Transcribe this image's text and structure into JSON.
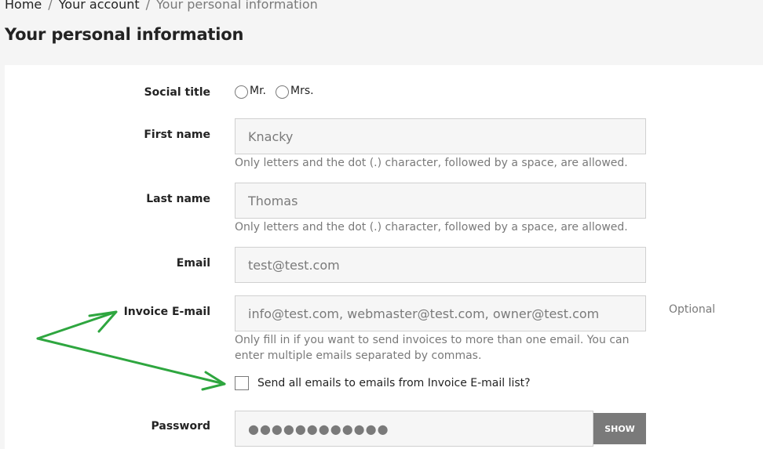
{
  "breadcrumb": {
    "items": [
      "Home",
      "Your account",
      "Your personal information"
    ],
    "separator": "/"
  },
  "page_title": "Your personal information",
  "form": {
    "social_title": {
      "label": "Social title",
      "options": [
        "Mr.",
        "Mrs."
      ]
    },
    "first_name": {
      "label": "First name",
      "value": "Knacky",
      "hint": "Only letters and the dot (.) character, followed by a space, are allowed."
    },
    "last_name": {
      "label": "Last name",
      "value": "Thomas",
      "hint": "Only letters and the dot (.) character, followed by a space, are allowed."
    },
    "email": {
      "label": "Email",
      "value": "test@test.com"
    },
    "invoice_email": {
      "label": "Invoice E-mail",
      "placeholder": "info@test.com, webmaster@test.com, owner@test.com",
      "optional": "Optional",
      "hint": "Only fill in if you want to send invoices to more than one email. You can enter multiple emails separated by commas."
    },
    "send_all_checkbox": {
      "label": "Send all emails to emails from Invoice E-mail list?"
    },
    "password": {
      "label": "Password",
      "value": "●●●●●●●●●●●●",
      "show_label": "SHOW"
    }
  },
  "annotation": {
    "arrow_color": "#2ea63f"
  },
  "colors": {
    "background": "#f5f5f5",
    "card": "#ffffff",
    "field_bg": "#f6f6f6",
    "muted_text": "#7a7a7a",
    "button": "#7a7a7a"
  }
}
